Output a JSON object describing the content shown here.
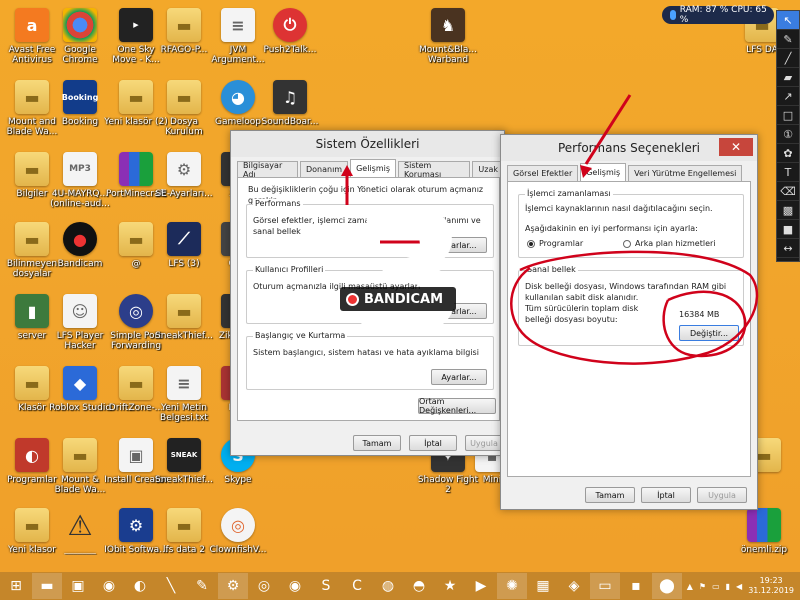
{
  "desktop": {
    "icons": [
      {
        "label": "Avast Free Antivirus"
      },
      {
        "label": "Google Chrome"
      },
      {
        "label": "One Sky Move - K..."
      },
      {
        "label": "RFAGO-P..."
      },
      {
        "label": "JVM Argument..."
      },
      {
        "label": "Push2Talk..."
      },
      {
        "label": "Mount&Bla... Warband"
      },
      {
        "label": "LFS DA"
      },
      {
        "label": "Mount and Blade Wa..."
      },
      {
        "label": "Booking"
      },
      {
        "label": "Yeni klasör (2)"
      },
      {
        "label": "Dosya Kurulum"
      },
      {
        "label": "Gameloop"
      },
      {
        "label": "SoundBoar..."
      },
      {
        "label": "Bilgiler"
      },
      {
        "label": "4U-MAYRQ... (online-aud..."
      },
      {
        "label": "PortMinecraft"
      },
      {
        "label": "SE-Ayarları..."
      },
      {
        "label": "Zikr"
      },
      {
        "label": "Bilinmeyen dosyalar"
      },
      {
        "label": "Bandicam"
      },
      {
        "label": "@"
      },
      {
        "label": "LFS (3)"
      },
      {
        "label": "GSA"
      },
      {
        "label": "server"
      },
      {
        "label": "LFS Player Hacker"
      },
      {
        "label": "Simple Port Forwarding"
      },
      {
        "label": "SneakThief..."
      },
      {
        "label": "Zikr tom"
      },
      {
        "label": "Klasör"
      },
      {
        "label": "Roblox Studio"
      },
      {
        "label": "DriftZone-..."
      },
      {
        "label": "Yeni Metin Belgesi.txt"
      },
      {
        "label": "Mod"
      },
      {
        "label": "Programlar"
      },
      {
        "label": "Mount & Blade Wa..."
      },
      {
        "label": "Install Creator"
      },
      {
        "label": "SneakThief..."
      },
      {
        "label": "Skype"
      },
      {
        "label": "Yeni klasor"
      },
      {
        "label": "_______"
      },
      {
        "label": "IObit Softwa..."
      },
      {
        "label": "lfs data 2"
      },
      {
        "label": "ClownfishV..."
      },
      {
        "label": "Shadow Fight 2"
      },
      {
        "label": "Mini"
      },
      {
        "label": "önemli.zip"
      }
    ]
  },
  "sysmon": {
    "text": "RAM: 87 %  CPU: 65 %"
  },
  "system_props": {
    "title": "Sistem Özellikleri",
    "tabs": [
      "Bilgisayar Adı",
      "Donanım",
      "Gelişmiş",
      "Sistem Koruması",
      "Uzak"
    ],
    "intro": "Bu değişikliklerin çoğu için Yönetici olarak oturum açmanız gerekir.",
    "perf_title": "Performans",
    "perf_desc": "Görsel efektler, işlemci zamanlaması, bellek kullanımı ve sanal bellek",
    "profiles_title": "Kullanıcı Profilleri",
    "profiles_desc": "Oturum açmanızla ilgili masaüstü ayarları",
    "startup_title": "Başlangıç ve Kurtarma",
    "startup_desc": "Sistem başlangıcı, sistem hatası ve hata ayıklama bilgisi",
    "settings_btn": "Ayarlar...",
    "env_btn": "Ortam Değişkenleri...",
    "ok": "Tamam",
    "cancel": "İptal",
    "apply": "Uygula"
  },
  "perf_options": {
    "title": "Performans Seçenekleri",
    "tabs": [
      "Görsel Efektler",
      "Gelişmiş",
      "Veri Yürütme Engellemesi"
    ],
    "cpu_title": "İşlemci zamanlaması",
    "cpu_desc": "İşlemci kaynaklarının nasıl dağıtılacağını seçin.",
    "adjust_label": "Aşağıdakinin en iyi performansı için ayarla:",
    "opt_programs": "Programlar",
    "opt_background": "Arka plan hizmetleri",
    "vm_title": "Sanal bellek",
    "vm_desc": "Disk belleği dosyası, Windows tarafından RAM gibi kullanılan sabit disk alanıdır.",
    "vm_total_label": "Tüm sürücülerin toplam disk belleği dosyası boyutu:",
    "vm_total_value": "16384 MB",
    "change_btn": "Değiştir...",
    "ok": "Tamam",
    "cancel": "İptal",
    "apply": "Uygula"
  },
  "overlay": {
    "step_number": "3",
    "watermark": "BANDICAM"
  },
  "taskbar": {
    "time": "19:23",
    "date": "31.12.2019"
  },
  "colors": {
    "annotation_red": "#d0021b",
    "desktop": "#f1a52c",
    "taskbar": "#c5862a"
  }
}
